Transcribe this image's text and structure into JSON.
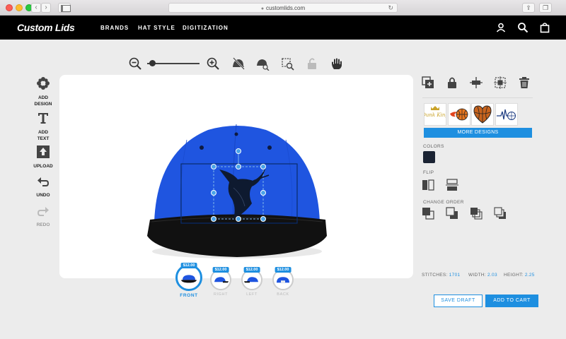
{
  "browser": {
    "url": "customlids.com"
  },
  "header": {
    "logo": "Custom Lids",
    "nav": [
      "BRANDS",
      "HAT STYLE",
      "DIGITIZATION"
    ]
  },
  "tools": [
    {
      "label_line1": "ADD",
      "label_line2": "DESIGN",
      "icon": "flower-icon"
    },
    {
      "label_line1": "ADD",
      "label_line2": "TEXT",
      "icon": "text-icon"
    },
    {
      "label_line1": "UPLOAD",
      "label_line2": "",
      "icon": "upload-icon"
    },
    {
      "label_line1": "UNDO",
      "label_line2": "",
      "icon": "undo-icon"
    },
    {
      "label_line1": "REDO",
      "label_line2": "",
      "icon": "redo-icon"
    }
  ],
  "views": [
    {
      "label": "FRONT",
      "price": "$12.00",
      "active": true
    },
    {
      "label": "RIGHT",
      "price": "$12.00",
      "active": false
    },
    {
      "label": "LEFT",
      "price": "$12.00",
      "active": false
    },
    {
      "label": "BACK",
      "price": "$12.00",
      "active": false
    }
  ],
  "designs": {
    "more_label": "MORE DESIGNS",
    "thumb1_text": "Dunk King"
  },
  "sections": {
    "colors": "COLORS",
    "flip": "FLIP",
    "change_order": "CHANGE ORDER"
  },
  "colors": {
    "selected_swatch": "#1a2333",
    "accent": "#1e8fe0",
    "cap_crown": "#1f55e0",
    "cap_brim": "#111111"
  },
  "stats": {
    "stitches_label": "STITCHES:",
    "stitches": "1701",
    "width_label": "WIDTH:",
    "width": "2.03",
    "height_label": "HEIGHT:",
    "height": "2.25"
  },
  "actions": {
    "save_draft": "SAVE DRAFT",
    "add_to_cart": "ADD TO CART"
  }
}
